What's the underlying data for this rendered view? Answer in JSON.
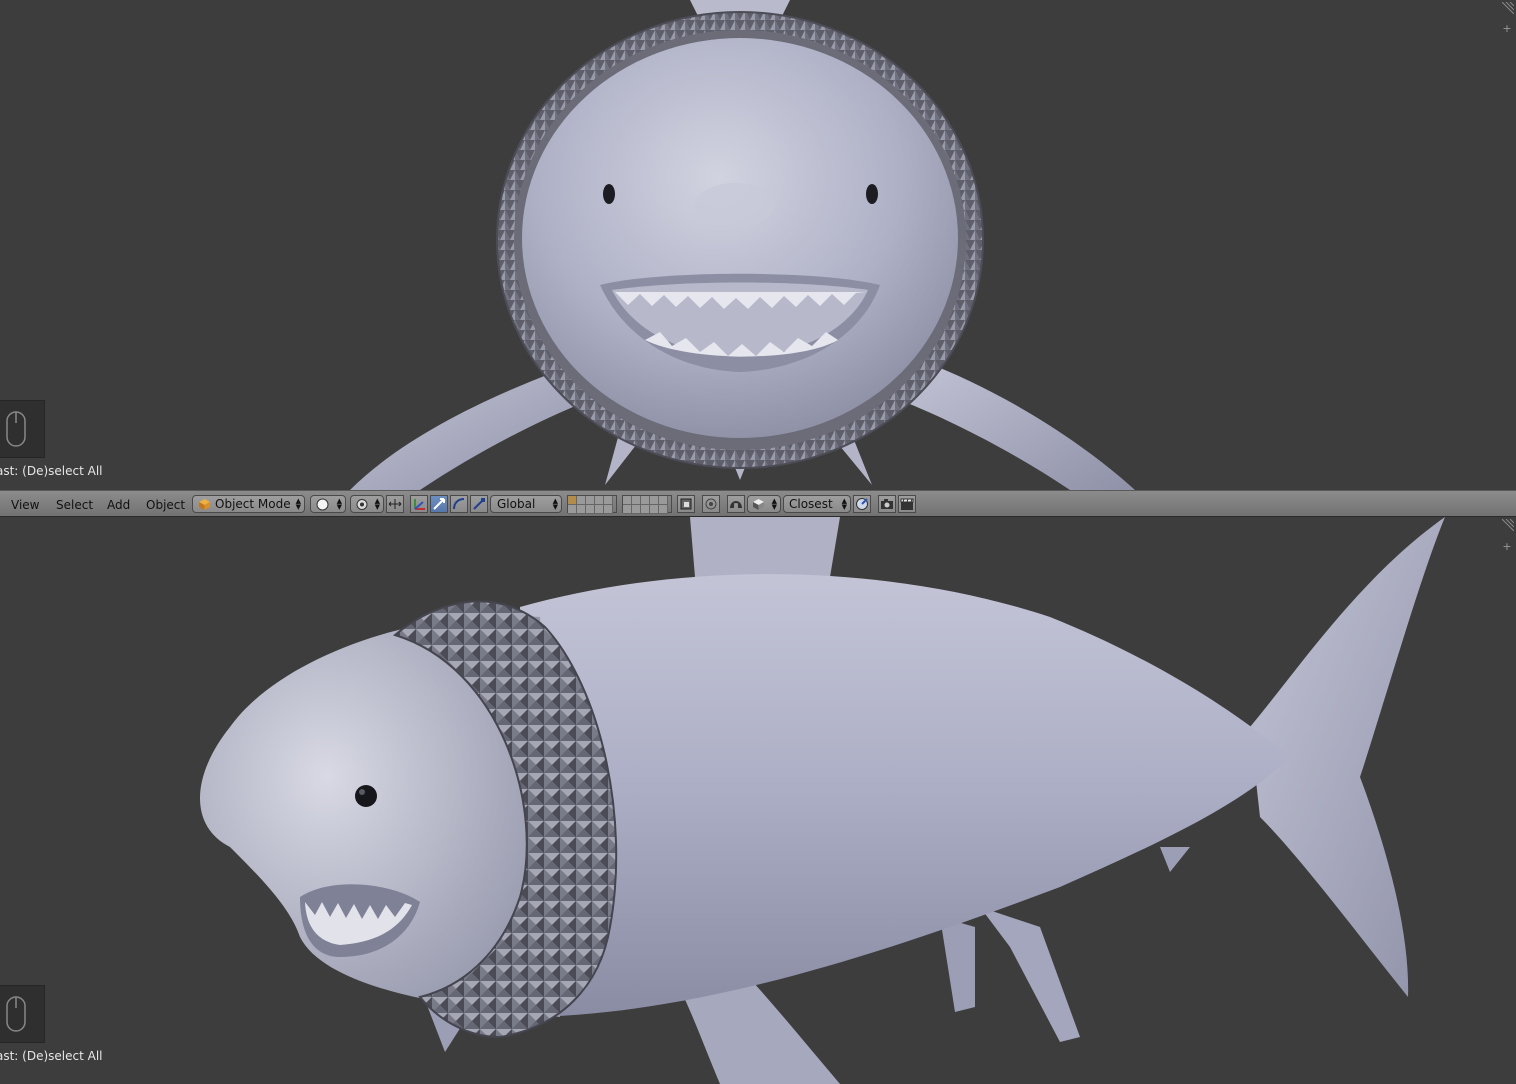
{
  "last_operator": "ast: (De)select All",
  "header": {
    "menus": [
      "View",
      "Select",
      "Add",
      "Object"
    ],
    "mode": "Object Mode",
    "orientation": "Global",
    "snap_target": "Closest"
  },
  "icons": {
    "mouse": "mouse-icon",
    "mode_cube": "cube-icon",
    "shading": "sphere-solid-icon",
    "pivot": "pivot-point-icon",
    "manipulator": "manipulator-icon",
    "translate": "translate-icon",
    "rotate": "rotate-icon",
    "scale": "scale-icon",
    "proportional": "proportional-edit-icon",
    "snap_magnet": "snap-magnet-icon",
    "snap_element": "snap-element-icon",
    "snap_align": "snap-align-icon",
    "render": "camera-icon",
    "render_anim": "clapper-icon"
  },
  "colors": {
    "viewport_bg": "#3d3d3d",
    "header_bg": "#7f7f7f",
    "mesh": "#a7a8bd",
    "active_blue": "#5680c2"
  }
}
